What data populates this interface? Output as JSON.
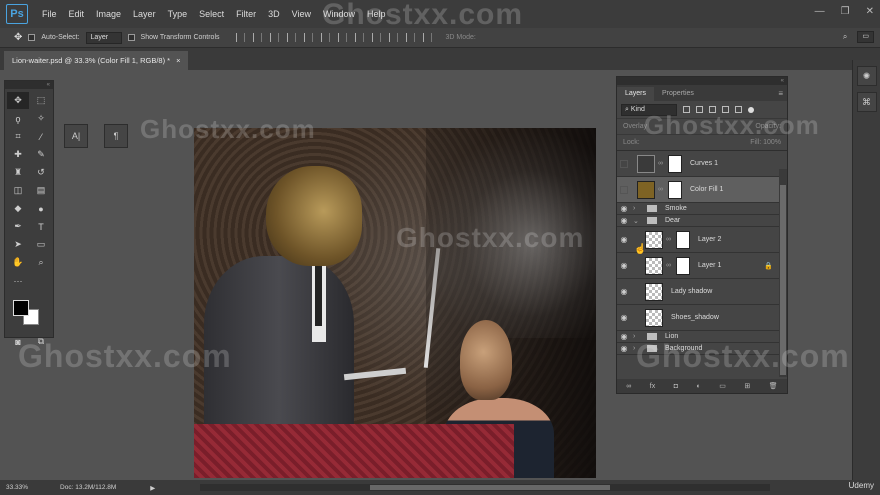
{
  "app": {
    "logo": "Ps"
  },
  "menu": [
    "File",
    "Edit",
    "Image",
    "Layer",
    "Type",
    "Select",
    "Filter",
    "3D",
    "View",
    "Window",
    "Help"
  ],
  "options": {
    "auto_select_label": "Auto-Select:",
    "auto_select_value": "Layer",
    "transform_label": "Show Transform Controls",
    "mode_3d": "3D Mode:",
    "workspace": "▭"
  },
  "doc_tab": {
    "title": "Lion-waiter.psd @ 33.3% (Color Fill 1, RGB/8) *",
    "close": "×"
  },
  "char_panel": {
    "char_btn": "A|",
    "para_btn": "¶"
  },
  "layers_panel": {
    "tabs": [
      "Layers",
      "Properties"
    ],
    "kind": "⌕ Kind",
    "blend_mode": "Overlay",
    "opacity_label": "Opacity:",
    "lock_label": "Lock:",
    "fill_label": "Fill:",
    "fill_value": "100%",
    "layers": [
      {
        "name": "Curves 1",
        "visible": false,
        "type": "adjustment"
      },
      {
        "name": "Color Fill 1",
        "visible": false,
        "type": "fill",
        "selected": true
      },
      {
        "name": "Smoke",
        "visible": true,
        "type": "group"
      },
      {
        "name": "Dear",
        "visible": true,
        "type": "group",
        "open": true
      },
      {
        "name": "Layer 2",
        "visible": true,
        "type": "pixel-mask"
      },
      {
        "name": "Layer 1",
        "visible": true,
        "type": "pixel-mask",
        "locked": true
      },
      {
        "name": "Lady shadow",
        "visible": true,
        "type": "pixel"
      },
      {
        "name": "Shoes_shadow",
        "visible": true,
        "type": "pixel"
      },
      {
        "name": "Lion",
        "visible": true,
        "type": "group"
      },
      {
        "name": "Background",
        "visible": true,
        "type": "group"
      }
    ],
    "footer_icons": [
      "link-icon",
      "fx-icon",
      "mask-icon",
      "adjustment-icon",
      "folder-icon",
      "new-layer-icon",
      "trash-icon"
    ]
  },
  "status": {
    "zoom": "33.33%",
    "doc": "Doc: 13.2M/112.8M",
    "arrow": "▶"
  },
  "brand": {
    "udemy": "Udemy"
  },
  "watermark": "Ghostxx.com",
  "colors": {
    "accent": "#4aa3df",
    "fill_thumb": "#7e6324",
    "panel": "#454545",
    "workspace": "#535353"
  }
}
